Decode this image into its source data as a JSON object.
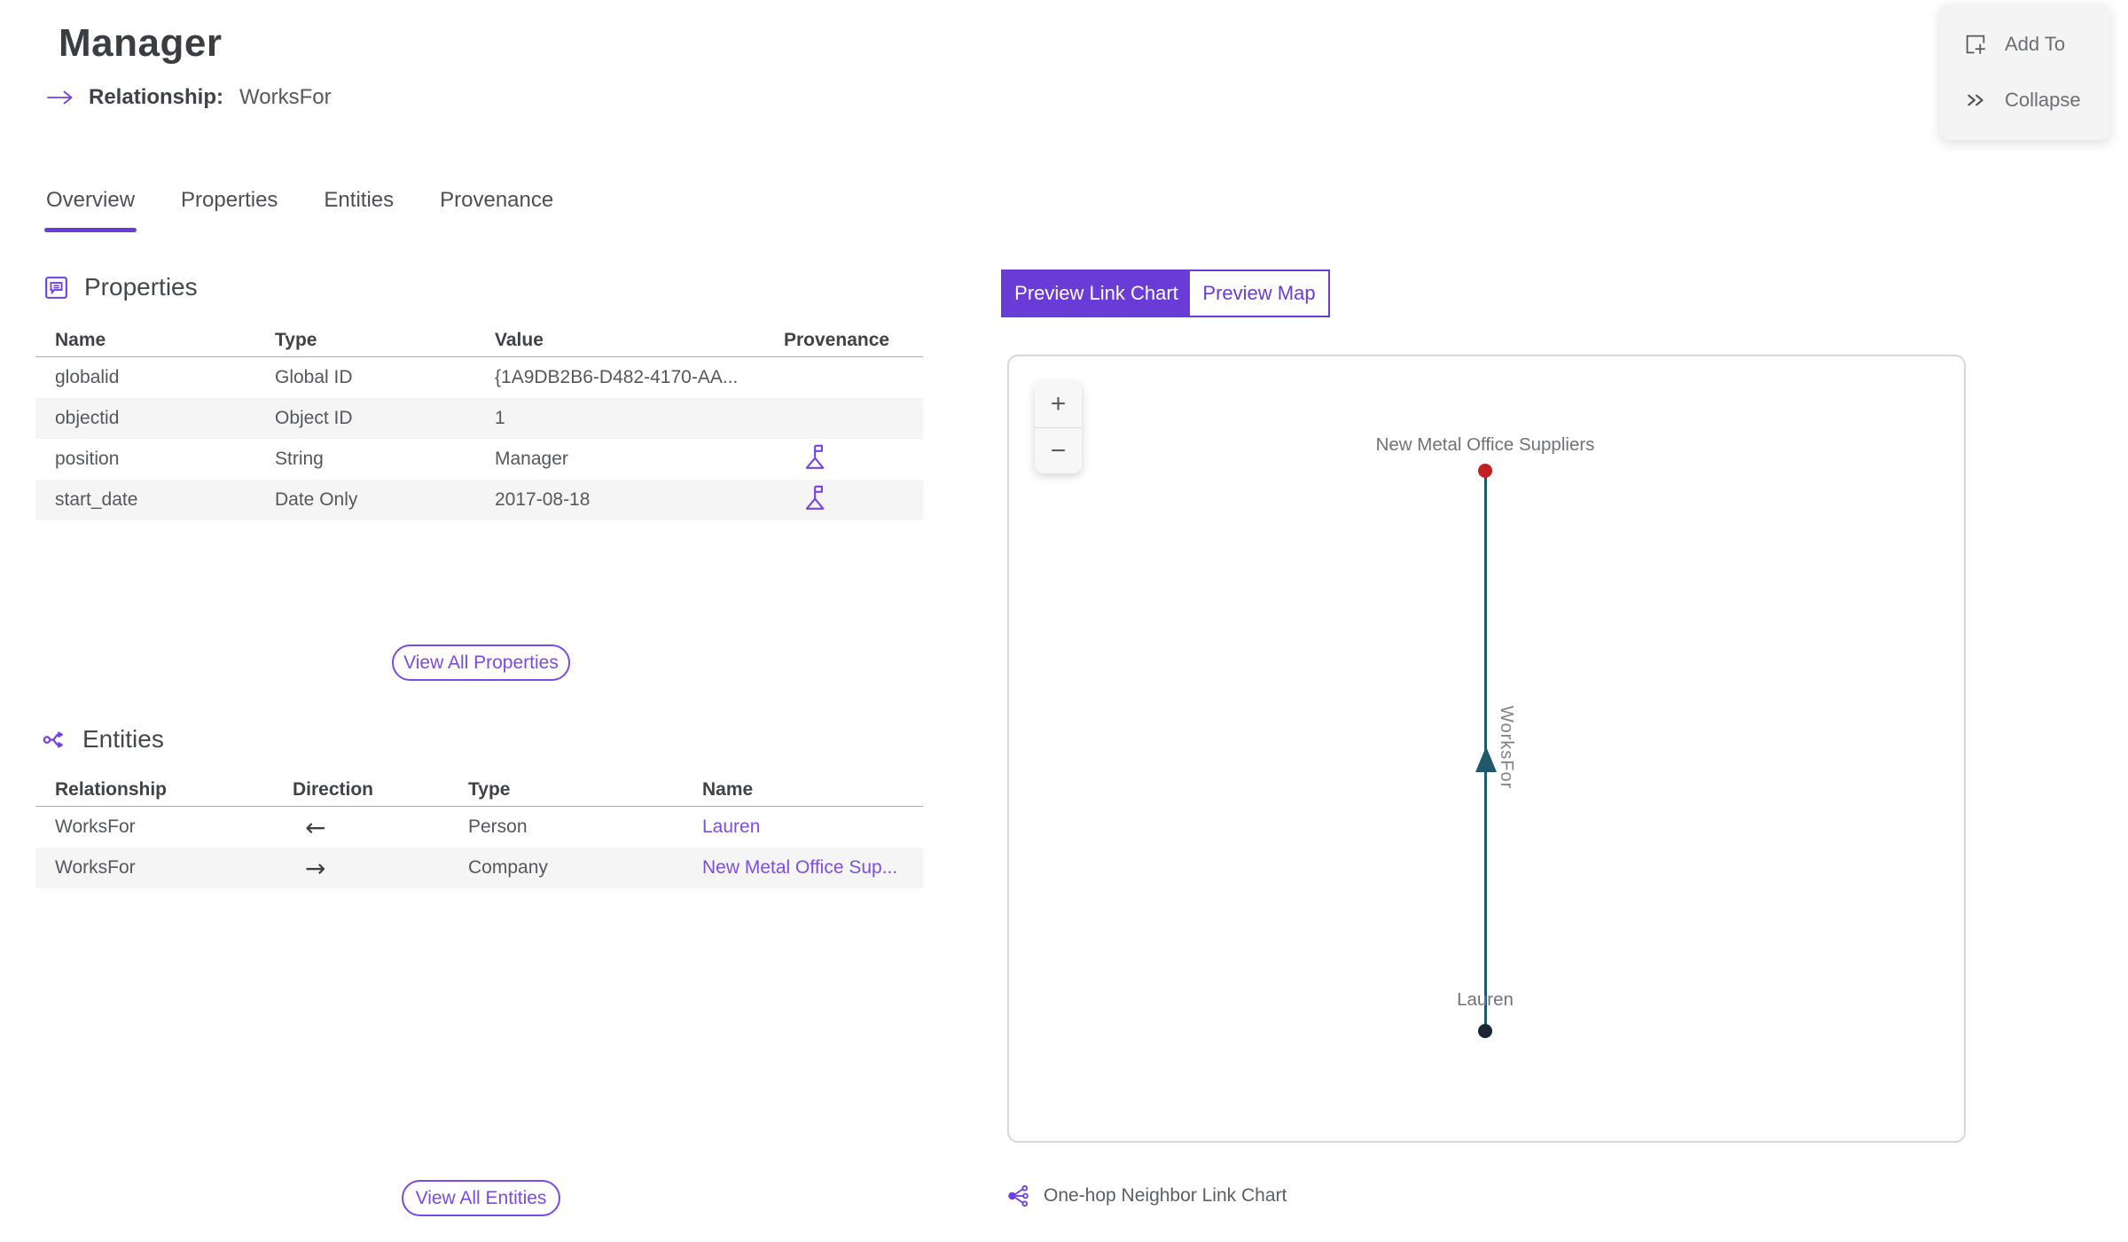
{
  "header": {
    "title": "Manager",
    "relationship_label": "Relationship:",
    "relationship_value": "WorksFor"
  },
  "actions_panel": {
    "add_to_label": "Add To",
    "collapse_label": "Collapse"
  },
  "tabs": [
    {
      "label": "Overview",
      "active": true
    },
    {
      "label": "Properties",
      "active": false
    },
    {
      "label": "Entities",
      "active": false
    },
    {
      "label": "Provenance",
      "active": false
    }
  ],
  "properties_section": {
    "title": "Properties",
    "columns": [
      "Name",
      "Type",
      "Value",
      "Provenance"
    ],
    "rows": [
      {
        "name": "globalid",
        "type": "Global ID",
        "value": "{1A9DB2B6-D482-4170-AA...",
        "has_provenance": false
      },
      {
        "name": "objectid",
        "type": "Object ID",
        "value": "1",
        "has_provenance": false
      },
      {
        "name": "position",
        "type": "String",
        "value": "Manager",
        "has_provenance": true
      },
      {
        "name": "start_date",
        "type": "Date Only",
        "value": "2017-08-18",
        "has_provenance": true
      }
    ],
    "view_all_label": "View All Properties"
  },
  "entities_section": {
    "title": "Entities",
    "columns": [
      "Relationship",
      "Direction",
      "Type",
      "Name"
    ],
    "rows": [
      {
        "relationship": "WorksFor",
        "direction": "incoming",
        "direction_glyph": "←",
        "type": "Person",
        "name": "Lauren"
      },
      {
        "relationship": "WorksFor",
        "direction": "outgoing",
        "direction_glyph": "→",
        "type": "Company",
        "name": "New Metal Office Sup..."
      }
    ],
    "view_all_label": "View All Entities"
  },
  "preview": {
    "toggle": {
      "link_chart_label": "Preview Link Chart",
      "map_label": "Preview Map",
      "active": "link_chart"
    },
    "zoom_in_label": "+",
    "zoom_out_label": "−",
    "caption": "One-hop Neighbor Link Chart",
    "link_chart": {
      "nodes": [
        {
          "label": "New Metal Office Suppliers",
          "color": "#c32121",
          "position": "top"
        },
        {
          "label": "Lauren",
          "color": "#1b2634",
          "position": "bottom"
        }
      ],
      "edge": {
        "label": "WorksFor",
        "color": "#20596c",
        "arrow_direction": "up"
      }
    }
  },
  "colors": {
    "accent_purple": "#693cd7",
    "link_purple": "#7c4fe3",
    "edge_teal": "#20596c",
    "node_red": "#c32121",
    "node_dark": "#1b2634"
  }
}
